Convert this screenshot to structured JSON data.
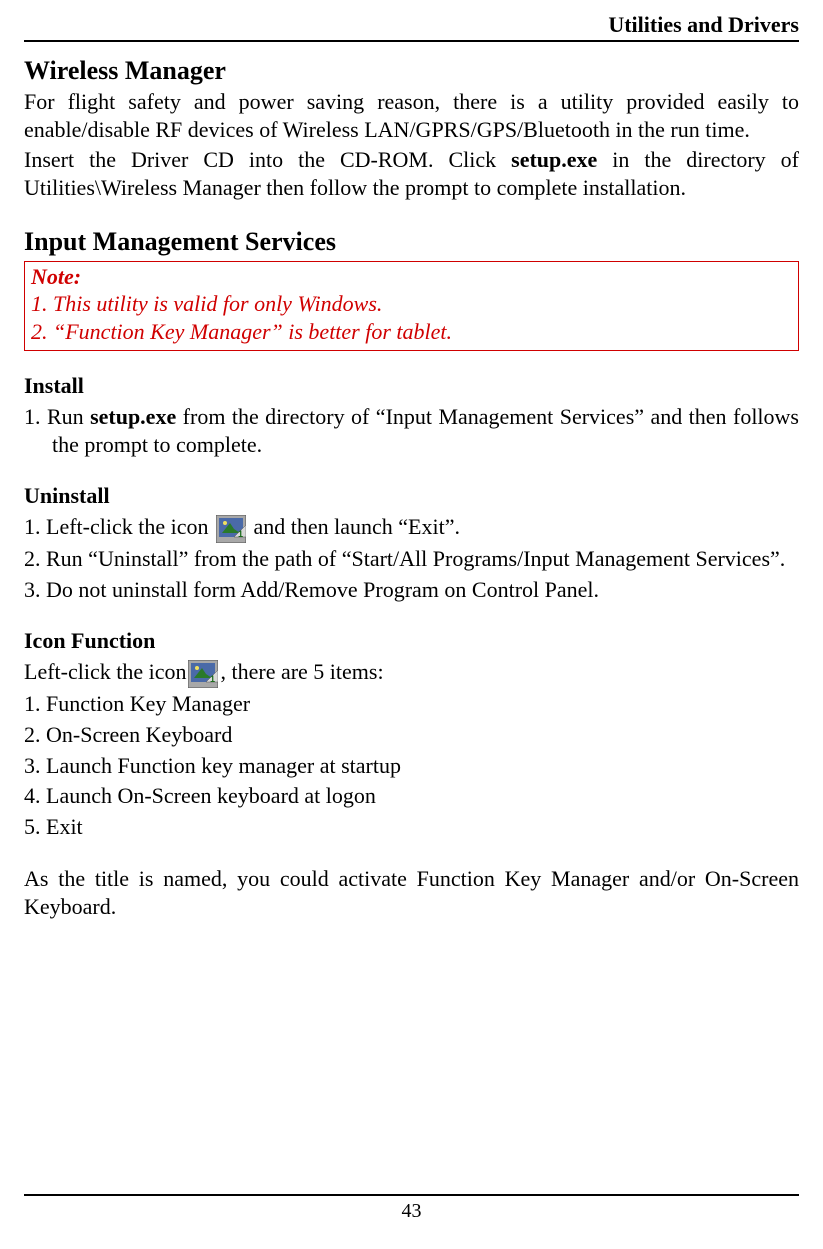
{
  "header": {
    "chapter": "Utilities and Drivers"
  },
  "wireless": {
    "title": "Wireless Manager",
    "p1": "For flight safety and power saving reason, there is a utility provided easily to enable/disable RF devices of Wireless LAN/GPRS/GPS/Bluetooth in the run time.",
    "p2a": "Insert the Driver CD into the CD-ROM. Click ",
    "p2_bold": "setup.exe",
    "p2b": " in the directory of Utilities\\Wireless Manager then follow the prompt to complete installation."
  },
  "ims": {
    "title": "Input Management Services",
    "note": {
      "title": "Note:",
      "line1": "1. This utility is valid for only Windows.",
      "line2": "2. “Function Key Manager” is better for tablet."
    },
    "install": {
      "title": "Install",
      "i1a": "1. Run ",
      "i1_bold": "setup.exe",
      "i1b": " from the directory of “Input Management Services” and then follows the prompt to complete."
    },
    "uninstall": {
      "title": "Uninstall",
      "u1a": "1. Left-click the icon ",
      "u1b": " and then launch “Exit”.",
      "u2": "2. Run “Uninstall” from the path of “Start/All Programs/Input Management Services”.",
      "u3": "3. Do not uninstall form Add/Remove Program on Control Panel."
    },
    "iconfn": {
      "title": "Icon Function",
      "intro_a": "Left-click the icon",
      "intro_b": ", there are 5 items:",
      "items": [
        "1. Function Key Manager",
        "2. On-Screen Keyboard",
        "3. Launch Function key manager at startup",
        "4. Launch On-Screen keyboard at logon",
        "5. Exit"
      ],
      "outro": "As the title is named, you could activate Function Key Manager and/or On-Screen Keyboard."
    }
  },
  "page_number": "43"
}
